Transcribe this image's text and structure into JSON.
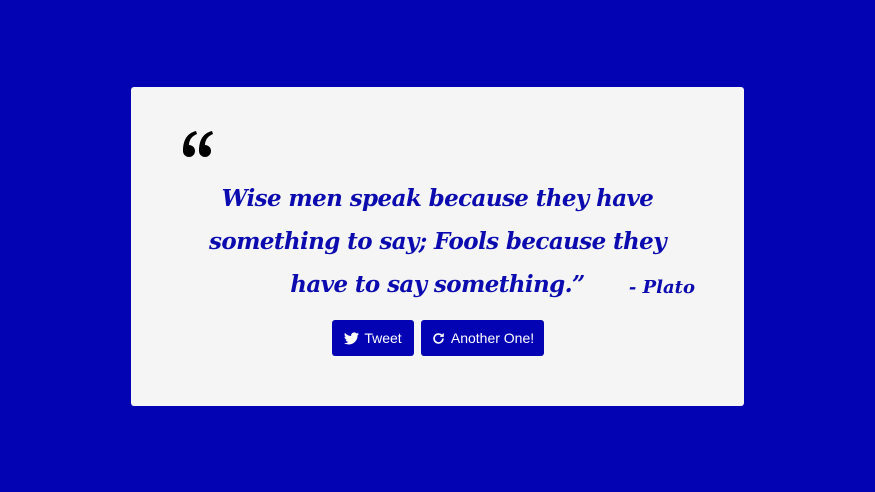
{
  "colors": {
    "background": "#0303b4",
    "card": "#f5f5f5",
    "accent": "#0b0bb0",
    "button_text": "#ffffff",
    "quote_mark": "#000000"
  },
  "quote": {
    "open_mark_icon": "quote-left-icon",
    "text": "Wise men speak because they have something to say; Fools because they have to say something.”",
    "author": "- Plato"
  },
  "buttons": {
    "tweet": {
      "label": "Tweet",
      "icon": "twitter-icon"
    },
    "another": {
      "label": "Another One!",
      "icon": "refresh-icon"
    }
  }
}
